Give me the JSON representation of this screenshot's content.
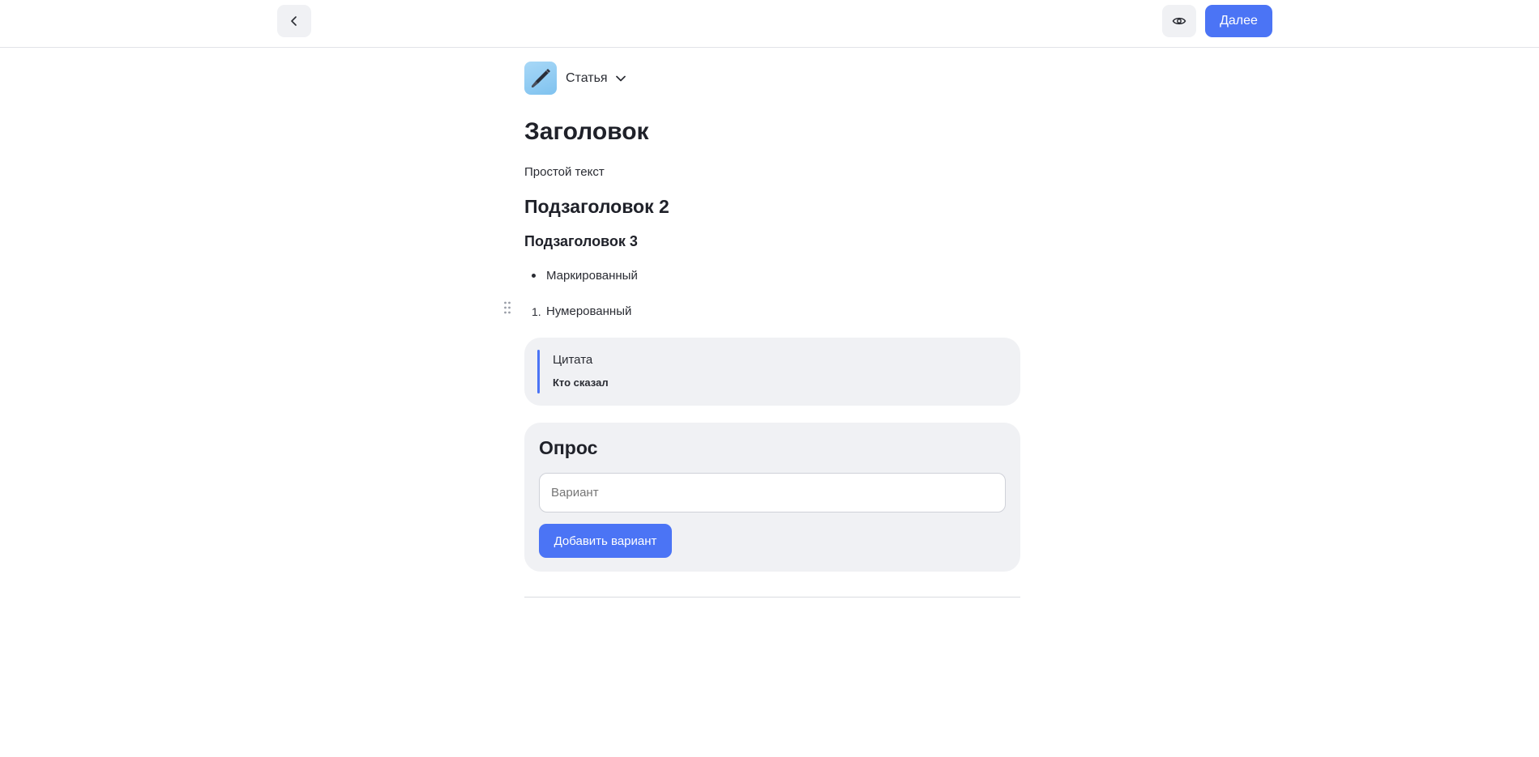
{
  "header": {
    "back_icon": "chevron-left-icon",
    "preview_icon": "eye-icon",
    "next_label": "Далее"
  },
  "editor": {
    "type_selector": {
      "icon": "pen-icon",
      "label": "Статья",
      "chevron": "chevron-down-icon"
    },
    "blocks": {
      "heading1": "Заголовок",
      "paragraph": "Простой текст",
      "heading2": "Подзаголовок 2",
      "heading3": "Подзаголовок 3",
      "bullet_item": "Маркированный",
      "numbered_marker": "1.",
      "numbered_item": "Нумерованный",
      "quote": {
        "text": "Цитата",
        "author": "Кто сказал"
      },
      "poll": {
        "title": "Опрос",
        "option_placeholder": "Вариант",
        "option_value": "",
        "add_option_label": "Добавить вариант"
      }
    }
  },
  "colors": {
    "accent": "#4b74f5",
    "card_background": "#f0f1f4"
  }
}
